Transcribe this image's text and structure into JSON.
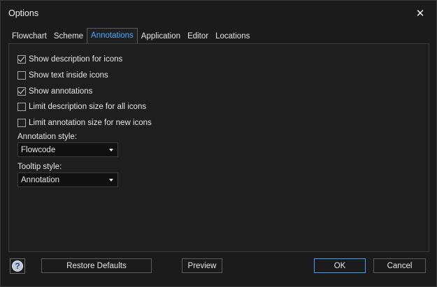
{
  "window": {
    "title": "Options",
    "close_glyph": "✕"
  },
  "tabs": [
    {
      "label": "Flowchart",
      "active": false
    },
    {
      "label": "Scheme",
      "active": false
    },
    {
      "label": "Annotations",
      "active": true
    },
    {
      "label": "Application",
      "active": false
    },
    {
      "label": "Editor",
      "active": false
    },
    {
      "label": "Locations",
      "active": false
    }
  ],
  "annotations": {
    "checkboxes": [
      {
        "label": "Show description for icons",
        "checked": true
      },
      {
        "label": "Show text inside icons",
        "checked": false
      },
      {
        "label": "Show annotations",
        "checked": true
      },
      {
        "label": "Limit description size for all icons",
        "checked": false
      },
      {
        "label": "Limit annotation size for new icons",
        "checked": false
      }
    ],
    "annotation_style": {
      "label": "Annotation style:",
      "value": "Flowcode"
    },
    "tooltip_style": {
      "label": "Tooltip style:",
      "value": "Annotation"
    }
  },
  "buttons": {
    "help_glyph": "?",
    "restore_defaults": "Restore Defaults",
    "preview": "Preview",
    "ok": "OK",
    "cancel": "Cancel"
  },
  "colors": {
    "accent": "#3aa0ff",
    "background": "#1b1b1b",
    "active_tab_text": "#4aa9ff"
  }
}
